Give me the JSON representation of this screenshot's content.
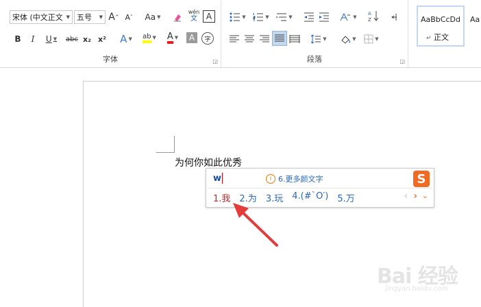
{
  "ribbon": {
    "font_group": {
      "font_name": "宋体 (中文正文",
      "font_size": "五号",
      "grow_label": "A",
      "shrink_label": "A",
      "case_label": "Aa",
      "phonetic_label": "wén",
      "phonetic_sub": "文",
      "border_char_label": "A",
      "bold": "B",
      "italic": "I",
      "underline": "U",
      "strike": "abc",
      "subscript": "x₂",
      "superscript": "x²",
      "effects": "A",
      "highlight": "ab",
      "font_color": "A",
      "char_shade": "A",
      "enclose": "字",
      "label": "字体"
    },
    "para_group": {
      "label": "段落"
    },
    "styles": {
      "normal_sample": "AaBbCcDd",
      "normal_name": "正文",
      "next_sample": "AaI"
    }
  },
  "document": {
    "text": "为何你如此优秀"
  },
  "ime": {
    "composition": "w",
    "hint_icon": "i",
    "hint_text": "6.更多颜文字",
    "logo": "S",
    "candidates": [
      "1.我",
      "2.为",
      "3.玩",
      "4.(#`O′)",
      "5.万"
    ],
    "prev": "‹",
    "next": "›",
    "more": "⌄"
  },
  "watermark": {
    "logo_text": "Bai 经验",
    "url": "jingyan.baidu.com"
  },
  "colors": {
    "accent": "#2a66b8",
    "first_candidate": "#d02020",
    "sogou_orange": "#f06a24",
    "arrow_red": "#e23c3c"
  },
  "icons": [
    "clear-format-icon",
    "bullets-icon",
    "numbering-icon",
    "multilevel-list-icon",
    "decrease-indent-icon",
    "increase-indent-icon",
    "chinese-layout-icon",
    "sort-icon",
    "show-marks-icon",
    "align-left-icon",
    "center-icon",
    "align-right-icon",
    "justify-icon",
    "distributed-icon",
    "line-spacing-icon",
    "shading-icon",
    "borders-icon"
  ]
}
